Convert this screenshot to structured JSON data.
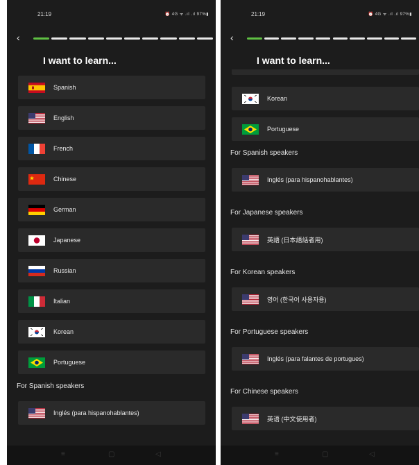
{
  "left_screen": {
    "status": {
      "time": "21:19",
      "icons": "⏰ 4G ᯤ .ıl .ıl 97%▮"
    },
    "title": "I want to learn...",
    "items": [
      {
        "label": "Spanish",
        "flag": "spain"
      },
      {
        "label": "English",
        "flag": "usa"
      },
      {
        "label": "French",
        "flag": "france"
      },
      {
        "label": "Chinese",
        "flag": "china"
      },
      {
        "label": "German",
        "flag": "germany"
      },
      {
        "label": "Japanese",
        "flag": "japan"
      },
      {
        "label": "Russian",
        "flag": "russia"
      },
      {
        "label": "Italian",
        "flag": "italy"
      },
      {
        "label": "Korean",
        "flag": "korea"
      },
      {
        "label": "Portuguese",
        "flag": "brazil"
      }
    ],
    "section": "For Spanish speakers",
    "section_item": {
      "label": "Inglés (para hispanohablantes)",
      "flag": "usa"
    }
  },
  "right_screen": {
    "status": {
      "time": "21:19",
      "icons": "⏰ 4G ᯤ .ıl .ıl 97%▮"
    },
    "title": "I want to learn...",
    "items": [
      {
        "label": "Korean",
        "flag": "korea"
      },
      {
        "label": "Portuguese",
        "flag": "brazil"
      }
    ],
    "sections": [
      {
        "header": "For Spanish speakers",
        "label": "Inglés (para hispanohablantes)",
        "flag": "usa"
      },
      {
        "header": "For Japanese speakers",
        "label": "英語 (日本語話者用)",
        "flag": "usa"
      },
      {
        "header": "For Korean speakers",
        "label": "영어 (한국어 사용자용)",
        "flag": "usa"
      },
      {
        "header": "For Portuguese speakers",
        "label": "Inglés (para falantes de portugues)",
        "flag": "usa"
      },
      {
        "header": "For Chinese speakers",
        "label": "英语 (中文使用者)",
        "flag": "usa"
      }
    ]
  },
  "progress": {
    "total_segments": 10,
    "completed_segments": 1,
    "completed_color": "#5fc043",
    "remaining_color": "#e9e9e9"
  },
  "nav": {
    "menu": "≡",
    "home": "▢",
    "back": "◁"
  }
}
